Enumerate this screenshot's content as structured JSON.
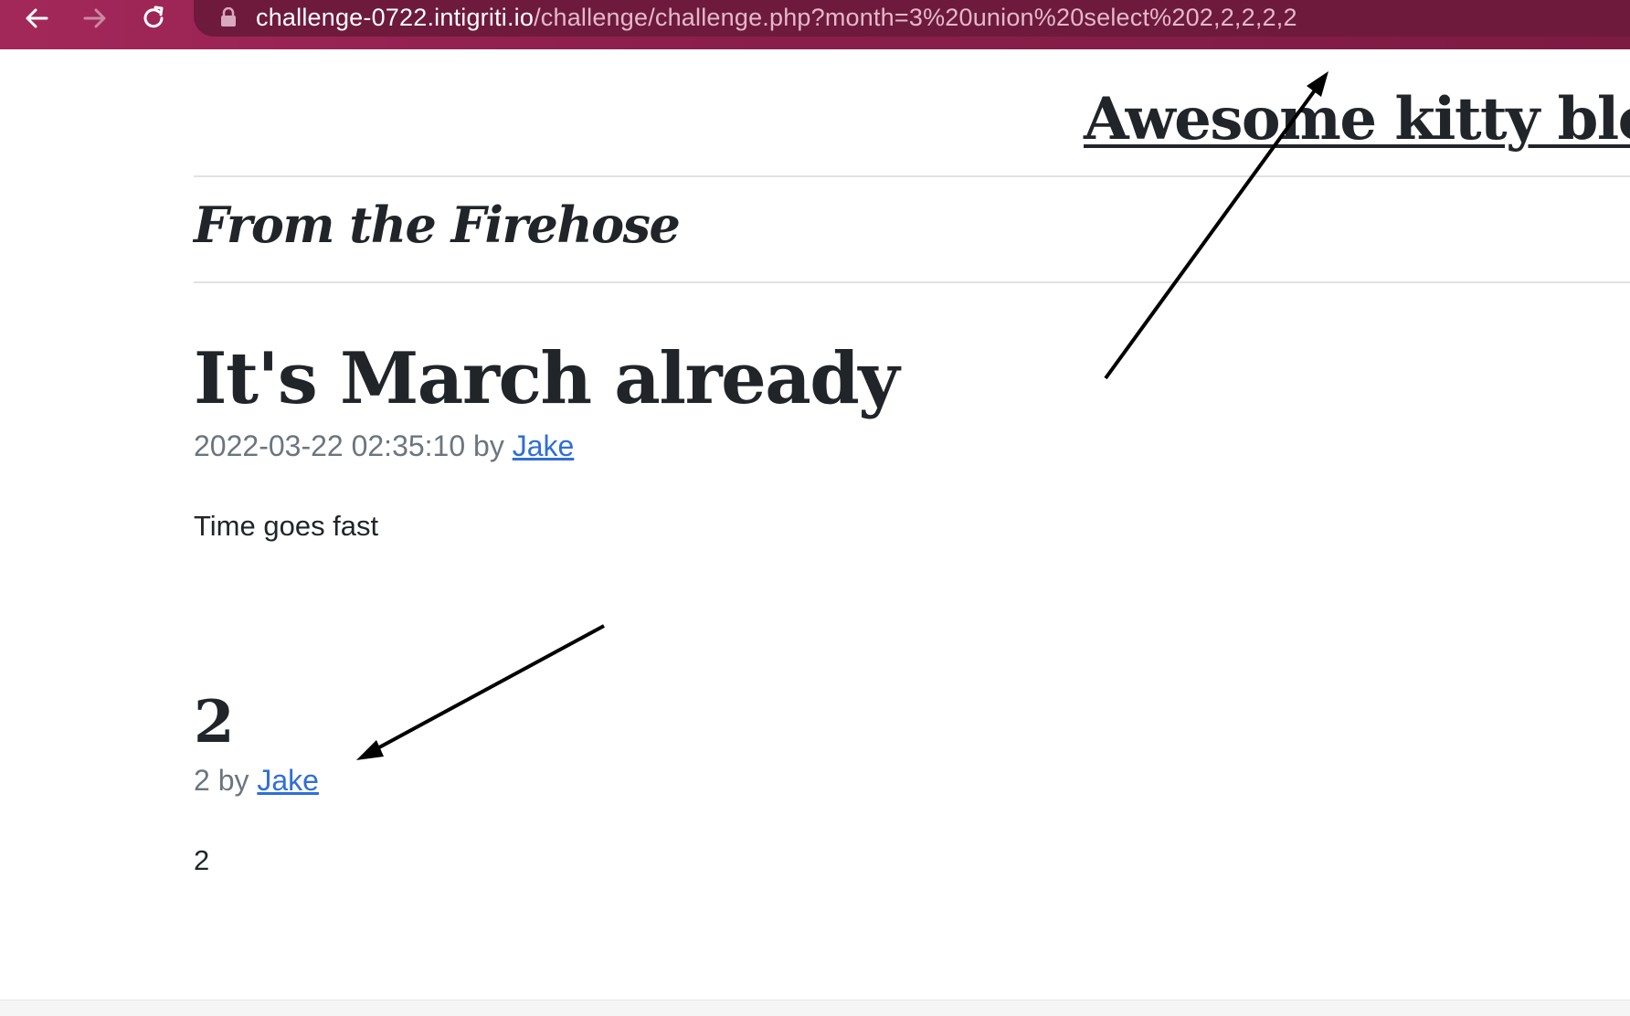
{
  "browser": {
    "url_host": "challenge-0722.intigriti.io",
    "url_path": "/challenge/challenge.php?month=3%20union%20select%202,2,2,2,2",
    "icons": {
      "back": "arrow-left-icon",
      "forward": "arrow-right-icon",
      "reload": "reload-icon",
      "lock": "lock-icon"
    },
    "colors": {
      "toolbar": "#8c1f4c",
      "omnibox": "#6e1a3c"
    }
  },
  "site": {
    "title": "Awesome kitty blo"
  },
  "section": {
    "heading": "From the Firehose"
  },
  "posts": [
    {
      "title": "It's March already",
      "date": "2022-03-22 02:35:10",
      "by": "by",
      "author": "Jake",
      "body": "Time goes fast"
    },
    {
      "title": "2",
      "date": "2",
      "by": "by",
      "author": "Jake",
      "body": "2"
    }
  ],
  "annotations": {
    "arrow_color": "#000000",
    "arrows": [
      "arrow pointing to URL query",
      "arrow pointing to injected post meta"
    ]
  }
}
